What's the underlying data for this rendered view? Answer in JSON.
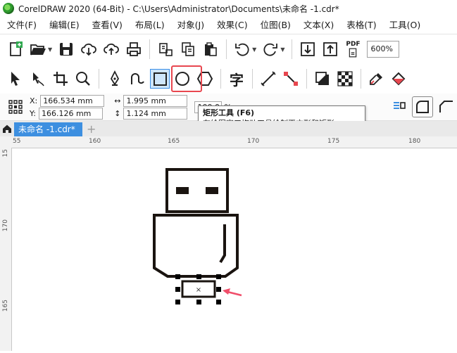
{
  "window": {
    "title": "CorelDRAW 2020 (64-Bit) - C:\\Users\\Administrator\\Documents\\未命名 -1.cdr*"
  },
  "menu": [
    "文件(F)",
    "编辑(E)",
    "查看(V)",
    "布局(L)",
    "对象(J)",
    "效果(C)",
    "位图(B)",
    "文本(X)",
    "表格(T)",
    "工具(O)"
  ],
  "toolbar": {
    "zoom": "600%",
    "pdf_label": "PDF"
  },
  "properties": {
    "x_label": "X:",
    "x_value": "166.534 mm",
    "y_label": "Y:",
    "y_value": "166.126 mm",
    "w_value": "1.995 mm",
    "h_value": "1.124 mm",
    "scale_value": "100.0",
    "scale_unit": "%"
  },
  "tools": {
    "text_tool_glyph": "字"
  },
  "tooltip": {
    "title": "矩形工具 (F6)",
    "description": "在绘图窗口拖动工具绘制正方形和矩形."
  },
  "tabs": {
    "document": "未命名 -1.cdr*",
    "add": "+"
  },
  "ruler": {
    "h_ticks": [
      "55",
      "160",
      "165",
      "170",
      "175",
      "180"
    ],
    "v_ticks": [
      "15",
      "170",
      "165"
    ]
  },
  "colors": {
    "accent": "#3d8fe0",
    "highlight": "#e8474f",
    "arrow": "#f04e6a"
  }
}
